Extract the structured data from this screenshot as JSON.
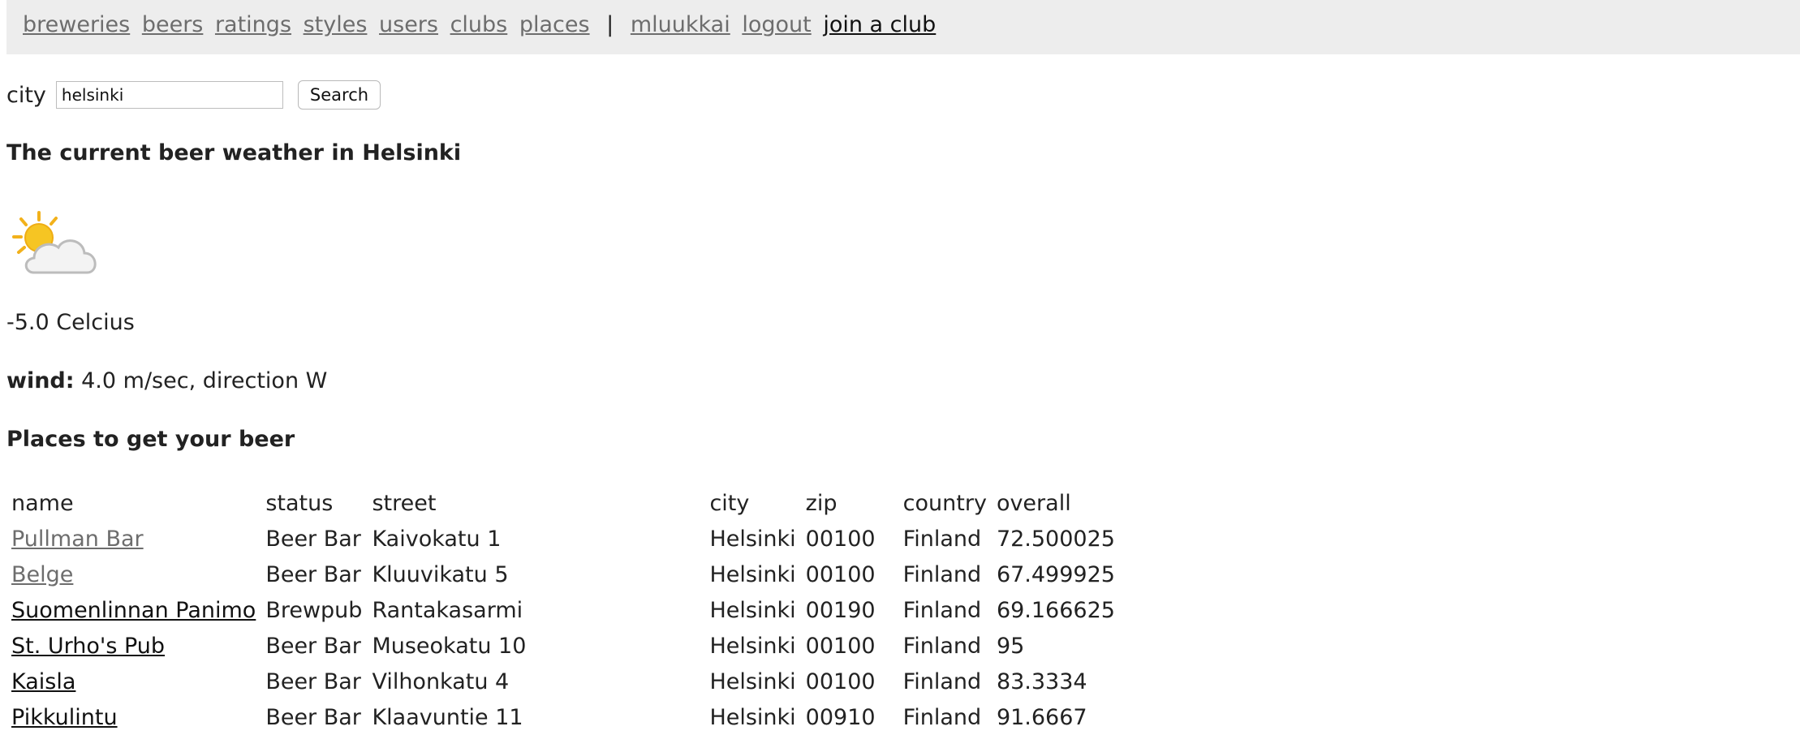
{
  "nav": {
    "links": [
      "breweries",
      "beers",
      "ratings",
      "styles",
      "users",
      "clubs",
      "places"
    ],
    "separator": "|",
    "user": "mluukkai",
    "logout": "logout",
    "join": "join a club"
  },
  "search": {
    "label": "city",
    "value": "helsinki",
    "button": "Search"
  },
  "weather": {
    "title": "The current beer weather in Helsinki",
    "icon": "partly-cloudy-icon",
    "temperature": "-5.0 Celcius",
    "wind_label": "wind:",
    "wind_value": " 4.0 m/sec, direction W"
  },
  "places": {
    "title": "Places to get your beer",
    "headers": [
      "name",
      "status",
      "street",
      "city",
      "zip",
      "country",
      "overall"
    ],
    "rows": [
      {
        "name": "Pullman Bar",
        "status": "Beer Bar",
        "street": "Kaivokatu 1",
        "city": "Helsinki",
        "zip": "00100",
        "country": "Finland",
        "overall": "72.500025"
      },
      {
        "name": "Belge",
        "status": "Beer Bar",
        "street": "Kluuvikatu 5",
        "city": "Helsinki",
        "zip": "00100",
        "country": "Finland",
        "overall": "67.499925"
      },
      {
        "name": "Suomenlinnan Panimo",
        "status": "Brewpub",
        "street": "Rantakasarmi",
        "city": "Helsinki",
        "zip": "00190",
        "country": "Finland",
        "overall": "69.166625"
      },
      {
        "name": "St. Urho's Pub",
        "status": "Beer Bar",
        "street": "Museokatu 10",
        "city": "Helsinki",
        "zip": "00100",
        "country": "Finland",
        "overall": "95"
      },
      {
        "name": "Kaisla",
        "status": "Beer Bar",
        "street": "Vilhonkatu 4",
        "city": "Helsinki",
        "zip": "00100",
        "country": "Finland",
        "overall": "83.3334"
      },
      {
        "name": "Pikkulintu",
        "status": "Beer Bar",
        "street": "Klaavuntie 11",
        "city": "Helsinki",
        "zip": "00910",
        "country": "Finland",
        "overall": "91.6667"
      }
    ]
  },
  "colors": {
    "navbar_bg": "#ededed",
    "link_gray": "#6d6d6d",
    "link_dark": "#111111"
  }
}
